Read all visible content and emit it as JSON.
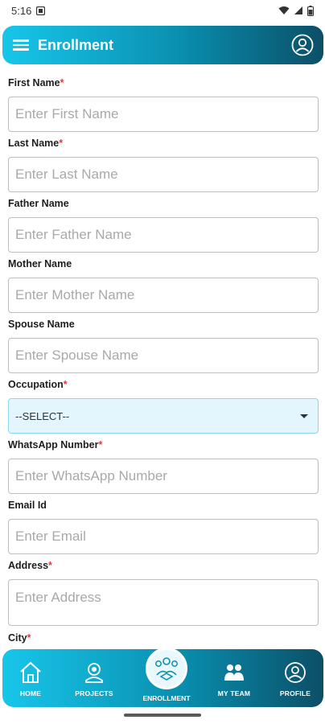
{
  "status_bar": {
    "time": "5:16"
  },
  "app_bar": {
    "title": "Enrollment",
    "menu_icon": "hamburger-menu-icon",
    "profile_icon": "account-circle-icon"
  },
  "form": {
    "first_name": {
      "label": "First Name",
      "required": "*",
      "placeholder": "Enter First Name"
    },
    "last_name": {
      "label": "Last Name",
      "required": "*",
      "placeholder": "Enter Last Name"
    },
    "father_name": {
      "label": "Father Name",
      "placeholder": "Enter Father Name"
    },
    "mother_name": {
      "label": "Mother Name",
      "placeholder": "Enter Mother Name"
    },
    "spouse_name": {
      "label": "Spouse Name",
      "placeholder": "Enter Spouse Name"
    },
    "occupation": {
      "label": "Occupation",
      "required": "*",
      "selected": "--SELECT--"
    },
    "whatsapp": {
      "label": "WhatsApp Number",
      "required": "*",
      "placeholder": "Enter WhatsApp Number"
    },
    "email": {
      "label": "Email Id",
      "placeholder": "Enter Email"
    },
    "address": {
      "label": "Address",
      "required": "*",
      "placeholder": "Enter Address"
    },
    "city": {
      "label": "City",
      "required": "*"
    }
  },
  "bottom_nav": {
    "home": "HOME",
    "projects": "PROJECTS",
    "enrollment": "ENROLLMENT",
    "my_team": "MY TEAM",
    "profile": "PROFILE"
  },
  "colors": {
    "accent_start": "#17c6ea",
    "accent_end": "#0b4f66",
    "required": "#e23b3b",
    "select_bg": "#e3f6fd"
  }
}
